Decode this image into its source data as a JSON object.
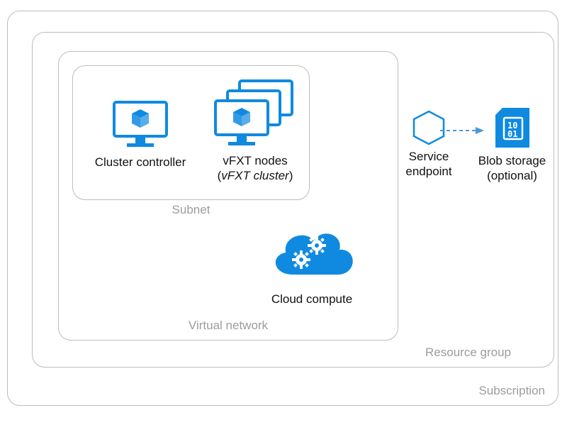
{
  "containers": {
    "subscription": "Subscription",
    "resource_group": "Resource group",
    "virtual_network": "Virtual network",
    "subnet": "Subnet"
  },
  "items": {
    "cluster_controller": {
      "label": "Cluster controller"
    },
    "vfxt_nodes": {
      "line1": "vFXT nodes",
      "line2_prefix": "(",
      "line2_italic": "vFXT cluster",
      "line2_suffix": ")"
    },
    "service_endpoint": {
      "line1": "Service",
      "line2": "endpoint"
    },
    "blob_storage": {
      "line1": "Blob storage",
      "line2": "(optional)"
    },
    "cloud_compute": {
      "label": "Cloud compute"
    }
  },
  "colors": {
    "azure_blue": "#0f8ae0",
    "container_border": "#bdbdbd",
    "container_label": "#9c9c9c"
  }
}
